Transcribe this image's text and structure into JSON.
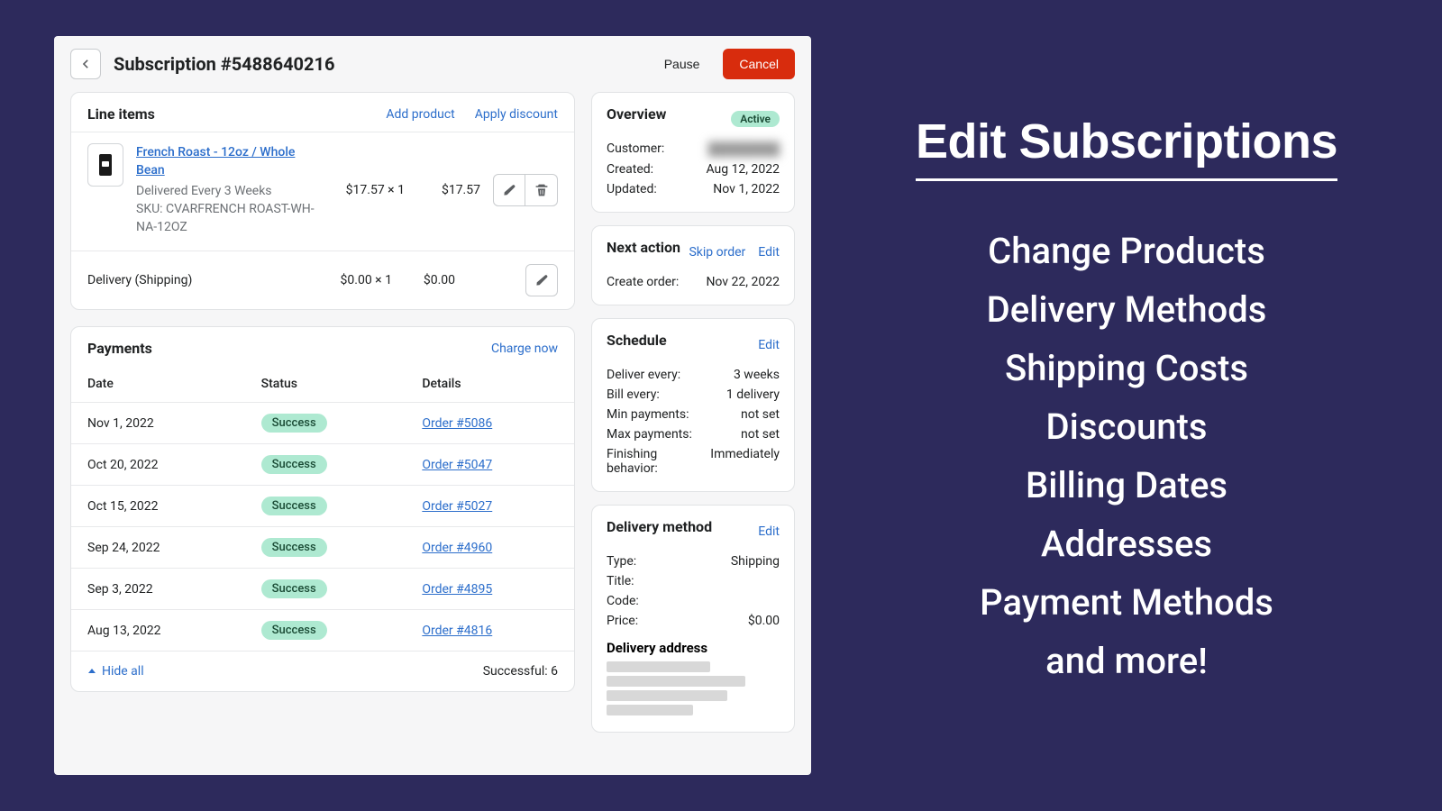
{
  "header": {
    "title": "Subscription #5488640216",
    "pause": "Pause",
    "cancel": "Cancel"
  },
  "lineItems": {
    "title": "Line items",
    "addProduct": "Add product",
    "applyDiscount": "Apply discount",
    "item": {
      "name": "French Roast - 12oz / Whole Bean",
      "delivery": "Delivered Every 3 Weeks",
      "sku": "SKU: CVARFRENCH ROAST-WH-NA-12OZ",
      "unit": "$17.57 × 1",
      "total": "$17.57"
    },
    "shipping": {
      "label": "Delivery (Shipping)",
      "unit": "$0.00 × 1",
      "total": "$0.00"
    }
  },
  "payments": {
    "title": "Payments",
    "chargeNow": "Charge now",
    "cols": {
      "date": "Date",
      "status": "Status",
      "details": "Details"
    },
    "rows": [
      {
        "date": "Nov 1, 2022",
        "status": "Success",
        "order": "Order #5086"
      },
      {
        "date": "Oct 20, 2022",
        "status": "Success",
        "order": "Order #5047"
      },
      {
        "date": "Oct 15, 2022",
        "status": "Success",
        "order": "Order #5027"
      },
      {
        "date": "Sep 24, 2022",
        "status": "Success",
        "order": "Order #4960"
      },
      {
        "date": "Sep 3, 2022",
        "status": "Success",
        "order": "Order #4895"
      },
      {
        "date": "Aug 13, 2022",
        "status": "Success",
        "order": "Order #4816"
      }
    ],
    "hideAll": "Hide all",
    "successful": "Successful: 6"
  },
  "overview": {
    "title": "Overview",
    "status": "Active",
    "customerLabel": "Customer:",
    "createdLabel": "Created:",
    "createdValue": "Aug 12, 2022",
    "updatedLabel": "Updated:",
    "updatedValue": "Nov 1, 2022"
  },
  "nextAction": {
    "title": "Next action",
    "skip": "Skip order",
    "edit": "Edit",
    "createLabel": "Create order:",
    "createValue": "Nov 22, 2022"
  },
  "schedule": {
    "title": "Schedule",
    "edit": "Edit",
    "rows": [
      {
        "label": "Deliver every:",
        "value": "3 weeks"
      },
      {
        "label": "Bill every:",
        "value": "1 delivery"
      },
      {
        "label": "Min payments:",
        "value": "not set"
      },
      {
        "label": "Max payments:",
        "value": "not set"
      },
      {
        "label": "Finishing behavior:",
        "value": "Immediately"
      }
    ]
  },
  "deliveryMethod": {
    "title": "Delivery method",
    "edit": "Edit",
    "rows": [
      {
        "label": "Type:",
        "value": "Shipping"
      },
      {
        "label": "Title:",
        "value": ""
      },
      {
        "label": "Code:",
        "value": ""
      },
      {
        "label": "Price:",
        "value": "$0.00"
      }
    ],
    "addressTitle": "Delivery address"
  },
  "marketing": {
    "title": "Edit Subscriptions",
    "items": [
      "Change Products",
      "Delivery Methods",
      "Shipping Costs",
      "Discounts",
      "Billing Dates",
      "Addresses",
      "Payment Methods",
      "and more!"
    ]
  }
}
